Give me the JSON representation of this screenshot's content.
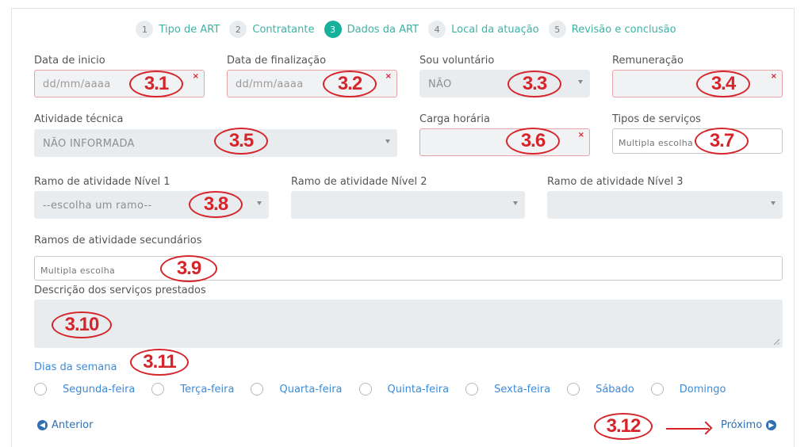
{
  "steps": [
    {
      "num": "1",
      "label": "Tipo de ART"
    },
    {
      "num": "2",
      "label": "Contratante"
    },
    {
      "num": "3",
      "label": "Dados da ART"
    },
    {
      "num": "4",
      "label": "Local da atuação"
    },
    {
      "num": "5",
      "label": "Revisão e conclusão"
    }
  ],
  "fields": {
    "data_inicio": {
      "label": "Data de inicio",
      "placeholder": "dd/mm/aaaa"
    },
    "data_finalizacao": {
      "label": "Data de finalização",
      "placeholder": "dd/mm/aaaa"
    },
    "voluntario": {
      "label": "Sou voluntário",
      "value": "NÃO"
    },
    "remuneracao": {
      "label": "Remuneração",
      "value": ""
    },
    "atividade_tecnica": {
      "label": "Atividade técnica",
      "value": "NÃO INFORMADA"
    },
    "carga_horaria": {
      "label": "Carga horária",
      "value": ""
    },
    "tipos_servicos": {
      "label": "Tipos de serviços",
      "placeholder": "Multipla escolha"
    },
    "ramo1": {
      "label": "Ramo de atividade  Nível 1",
      "value": "--escolha um ramo--"
    },
    "ramo2": {
      "label": "Ramo de atividade  Nível 2",
      "value": ""
    },
    "ramo3": {
      "label": "Ramo de atividade  Nível 3",
      "value": ""
    },
    "ramos_secundarios": {
      "label": "Ramos de atividade secundários",
      "placeholder": "Multipla escolha"
    },
    "descricao": {
      "label": "Descrição dos serviços prestados",
      "value": ""
    }
  },
  "clear_mark": "×",
  "week": {
    "title": "Dias da semana",
    "days": [
      "Segunda-feira",
      "Terça-feira",
      "Quarta-feira",
      "Quinta-feira",
      "Sexta-feira",
      "Sábado",
      "Domingo"
    ]
  },
  "nav": {
    "prev": "Anterior",
    "next": "Próximo"
  },
  "annotations": {
    "a1": "3.1",
    "a2": "3.2",
    "a3": "3.3",
    "a4": "3.4",
    "a5": "3.5",
    "a6": "3.6",
    "a7": "3.7",
    "a8": "3.8",
    "a9": "3.9",
    "a10": "3.10",
    "a11": "3.11",
    "a12": "3.12"
  },
  "colors": {
    "accent": "#17b19b",
    "link": "#3c8bd9",
    "annotation": "#d5252b",
    "invalid_border": "#e8a3a8"
  }
}
